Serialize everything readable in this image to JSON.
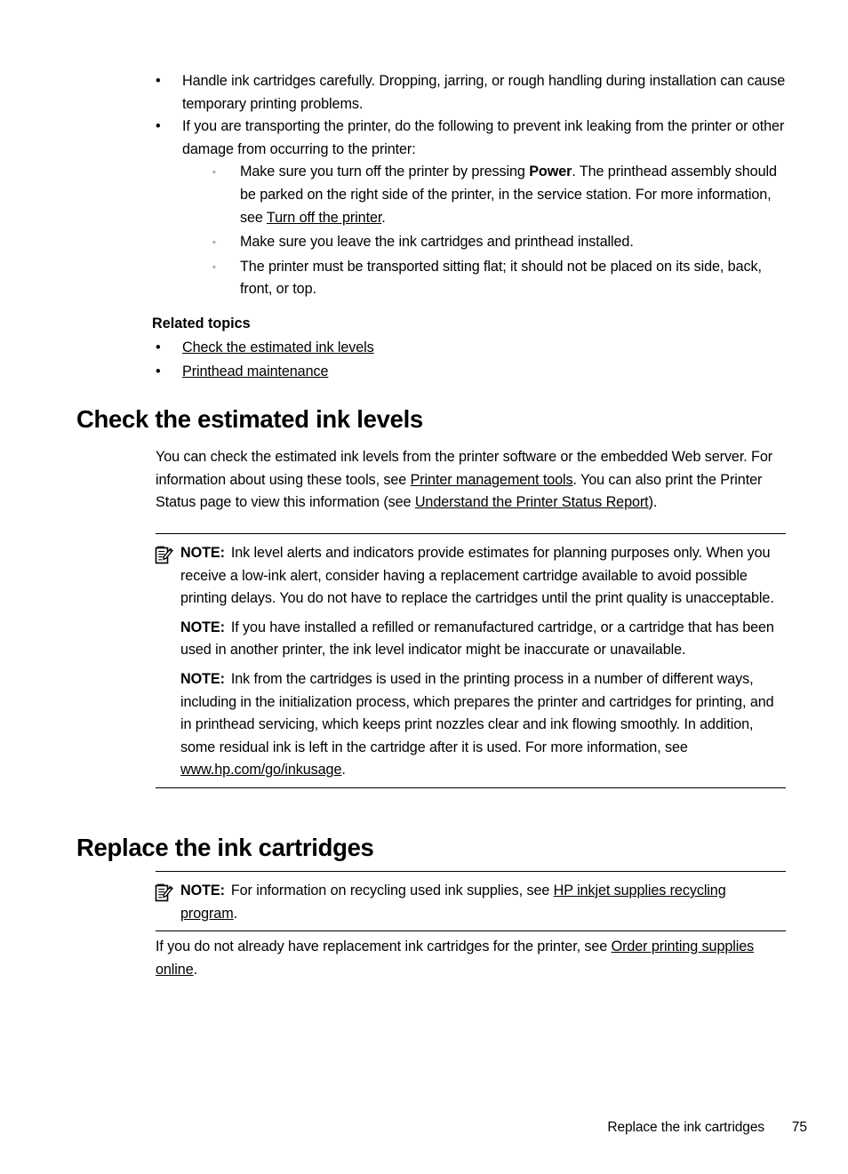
{
  "document": {
    "type": "printer-user-guide-page",
    "page_number": "75",
    "footer_section_title": "Replace the ink cartridges"
  },
  "top_list": {
    "items": [
      {
        "bullet": "•",
        "text": "Handle ink cartridges carefully. Dropping, jarring, or rough handling during installation can cause temporary printing problems."
      },
      {
        "bullet": "•",
        "text": "If you are transporting the printer, do the following to prevent ink leaking from the printer or other damage from occurring to the printer:",
        "sub_items": [
          {
            "bullet": "◦",
            "pre": "Make sure you turn off the printer by pressing ",
            "bold": "Power",
            "mid": ". The printhead assembly should be parked on the right side of the printer, in the service station. For more information, see ",
            "link": "Turn off the printer",
            "post": "."
          },
          {
            "bullet": "◦",
            "text": "Make sure you leave the ink cartridges and printhead installed."
          },
          {
            "bullet": "◦",
            "text": "The printer must be transported sitting flat; it should not be placed on its side, back, front, or top."
          }
        ]
      }
    ]
  },
  "related_topics": {
    "title": "Related topics",
    "items": [
      {
        "bullet": "•",
        "link": "Check the estimated ink levels"
      },
      {
        "bullet": "•",
        "link": "Printhead maintenance"
      }
    ]
  },
  "section_check": {
    "heading": "Check the estimated ink levels",
    "intro": {
      "p1": "You can check the estimated ink levels from the printer software or the embedded Web server. For information about using these tools, see ",
      "link1": "Printer management tools",
      "p2": ". You can also print the Printer Status page to view this information (see ",
      "link2": "Understand the Printer Status Report",
      "p3": ")."
    },
    "notes": [
      {
        "icon": "note-pencil-icon",
        "label": "NOTE:",
        "text": "Ink level alerts and indicators provide estimates for planning purposes only. When you receive a low-ink alert, consider having a replacement cartridge available to avoid possible printing delays. You do not have to replace the cartridges until the print quality is unacceptable."
      },
      {
        "icon": "",
        "label": "NOTE:",
        "text": "If you have installed a refilled or remanufactured cartridge, or a cartridge that has been used in another printer, the ink level indicator might be inaccurate or unavailable."
      },
      {
        "icon": "",
        "label": "NOTE:",
        "text_pre": "Ink from the cartridges is used in the printing process in a number of different ways, including in the initialization process, which prepares the printer and cartridges for printing, and in printhead servicing, which keeps print nozzles clear and ink flowing smoothly. In addition, some residual ink is left in the cartridge after it is used. For more information, see ",
        "link": "www.hp.com/go/inkusage",
        "text_post": "."
      }
    ]
  },
  "section_replace": {
    "heading": "Replace the ink cartridges",
    "note": {
      "icon": "note-pencil-icon",
      "label": "NOTE:",
      "text_pre": "For information on recycling used ink supplies, see ",
      "link": "HP inkjet supplies recycling program",
      "text_post": "."
    },
    "closing": {
      "pre": "If you do not already have replacement ink cartridges for the printer, see ",
      "link": "Order printing supplies online",
      "post": "."
    }
  },
  "colors": {
    "text": "#000000",
    "background": "#ffffff",
    "rule": "#000000"
  }
}
